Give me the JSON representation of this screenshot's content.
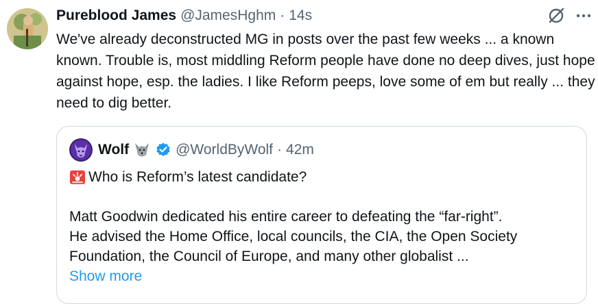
{
  "post": {
    "display_name": "Pureblood James",
    "handle": "@JamesHghm",
    "separator": "·",
    "time": "14s",
    "text": "We've already deconstructed MG in posts over the past few weeks ... a known known.  Trouble is, most middling Reform people have done no deep dives, just hope against hope, esp. the ladies. I like Reform peeps, love some of em but really ... they need to dig better.",
    "icons": [
      "grok-icon",
      "more-icon"
    ]
  },
  "quote": {
    "display_name": "Wolf",
    "name_emoji": "wolf-emoji",
    "verified": "verified-badge-icon",
    "handle": "@WorldByWolf",
    "separator": "·",
    "time": "42m",
    "lead_emoji": "police-light-emoji",
    "line1": "Who is Reform’s latest candidate?",
    "body_lines": [
      "Matt Goodwin dedicated his entire career to defeating the “far-right”.",
      "He advised the Home Office, local councils, the CIA, the Open Society",
      "Foundation, the Council of Europe, and many other globalist ..."
    ],
    "show_more": "Show more"
  },
  "colors": {
    "text": "#0f1419",
    "secondary": "#536471",
    "link": "#1d9bf0",
    "border": "#cfd9de",
    "verified": "#1d9bf0"
  }
}
